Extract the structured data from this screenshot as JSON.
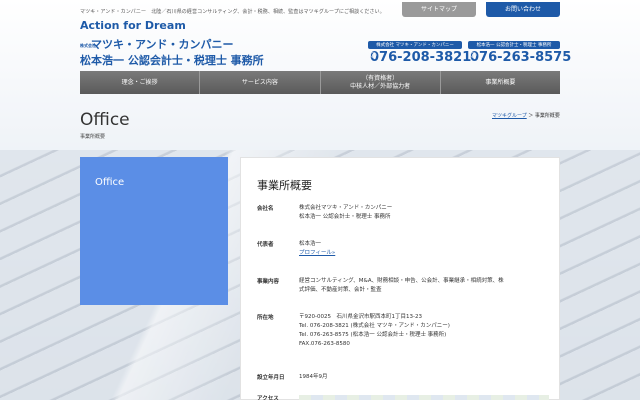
{
  "header": {
    "topline": "マツキ・アンド・カンパニー　北陸／石川県の経営コンサルティング、会計・税務、相続、監査はマツキグループにご相談ください。",
    "sitemap_label": "サイトマップ",
    "contact_label": "お問い合わせ",
    "slogan": "Action for Dream",
    "kabushiki": "株式会社",
    "company_name_1": "マツキ・アンド・カンパニー",
    "company_name_2": "松本浩一 公認会計士・税理士 事務所",
    "phones": [
      {
        "label": "株式会社 マツキ・アンド・カンパニー",
        "number": "076-208-3821"
      },
      {
        "label": "松本浩一 公認会計士・税理士 事務所",
        "number": "076-263-8575"
      }
    ]
  },
  "nav": {
    "items": [
      {
        "label": "理念・ご挨拶"
      },
      {
        "label": "サービス内容"
      },
      {
        "label_line1": "（有資格者）",
        "label_line2": "中核人材／外部協力者"
      },
      {
        "label": "事業所概要"
      }
    ]
  },
  "page": {
    "title": "Office",
    "subtitle": "事業所概要",
    "breadcrumb_home": "マツキグループ",
    "breadcrumb_sep": "＞",
    "breadcrumb_current": "事業所概要",
    "side_label": "Office"
  },
  "content": {
    "heading": "事業所概要",
    "rows": [
      {
        "key": "会社名",
        "lines": [
          "株式会社マツキ・アンド・カンパニー",
          "松本浩一 公認会計士・税理士 事務所"
        ]
      },
      {
        "key": "代表者",
        "lines": [
          "松本浩一"
        ],
        "link": "プロフィール»"
      },
      {
        "key": "事業内容",
        "lines": [
          "経営コンサルティング、M&A、財務相談・申告、公会計、事業継承・相続対策、株",
          "式評価、不動産対策、会計・監査"
        ]
      },
      {
        "key": "所在地",
        "lines": [
          "〒920-0025　石川県金沢市駅西本町1丁目13-23",
          "Tel. 076-208-3821 (株式会社 マツキ・アンド・カンパニー)",
          "Tel. 076-263-8575 (松本浩一 公認会計士・税理士 事務所)",
          "FAX.076-263-8580"
        ]
      },
      {
        "key": "設立年月日",
        "lines": [
          "1984年9月"
        ]
      },
      {
        "key": "アクセス",
        "lines": [
          ""
        ]
      }
    ]
  },
  "colors": {
    "brand_blue": "#1e5aa8",
    "side_box": "#5b8ee6",
    "nav_gray": "#6b6b6b"
  }
}
